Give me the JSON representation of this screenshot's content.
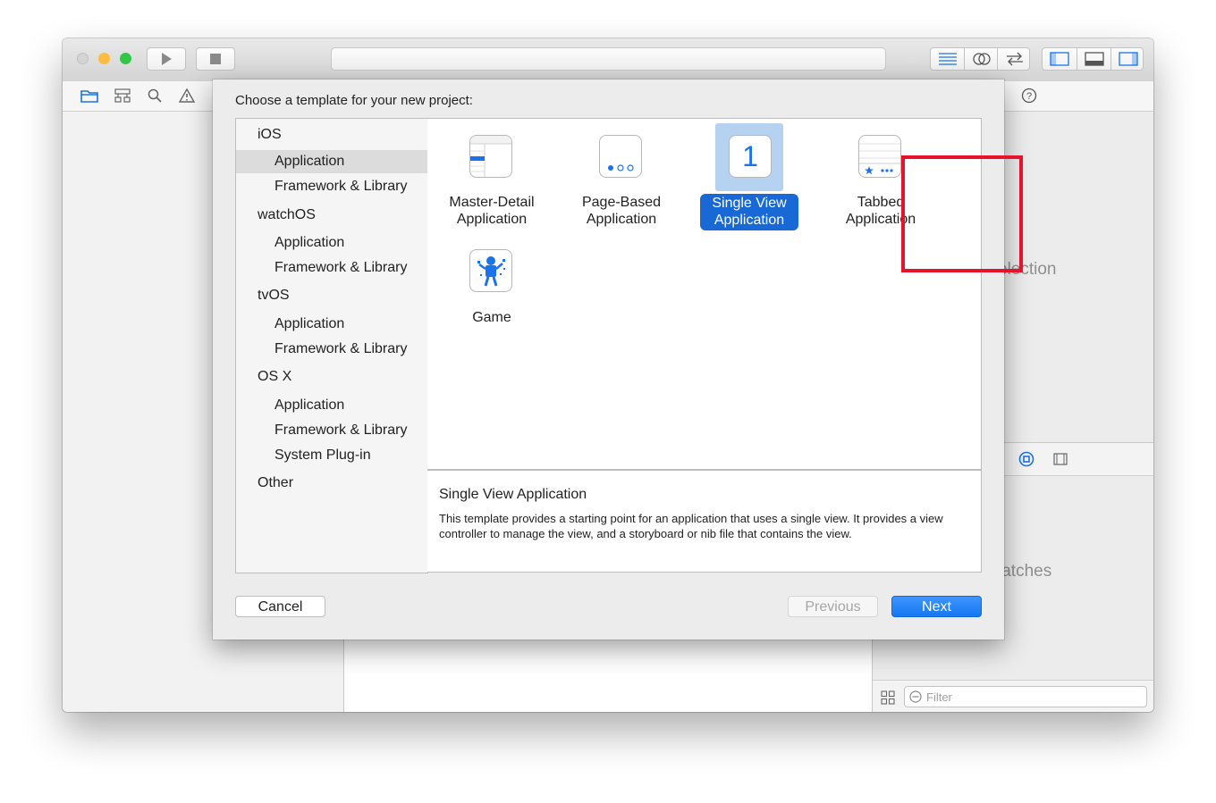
{
  "window": {
    "inspector_ghost_top": "election",
    "inspector_ghost_bottom": "latches",
    "filter_placeholder": "Filter"
  },
  "sheet": {
    "title": "Choose a template for your new project:",
    "sidebar": [
      {
        "label": "iOS",
        "type": "category"
      },
      {
        "label": "Application",
        "type": "item",
        "selected": true
      },
      {
        "label": "Framework & Library",
        "type": "item"
      },
      {
        "label": "watchOS",
        "type": "category"
      },
      {
        "label": "Application",
        "type": "item"
      },
      {
        "label": "Framework & Library",
        "type": "item"
      },
      {
        "label": "tvOS",
        "type": "category"
      },
      {
        "label": "Application",
        "type": "item"
      },
      {
        "label": "Framework & Library",
        "type": "item"
      },
      {
        "label": "OS X",
        "type": "category"
      },
      {
        "label": "Application",
        "type": "item"
      },
      {
        "label": "Framework & Library",
        "type": "item"
      },
      {
        "label": "System Plug-in",
        "type": "item"
      },
      {
        "label": "Other",
        "type": "category"
      }
    ],
    "templates": [
      {
        "line1": "Master-Detail",
        "line2": "Application",
        "icon": "master-detail-icon"
      },
      {
        "line1": "Page-Based",
        "line2": "Application",
        "icon": "page-based-icon"
      },
      {
        "line1": "Single View",
        "line2": "Application",
        "icon": "single-view-icon",
        "icon_text": "1",
        "selected": true
      },
      {
        "line1": "Tabbed",
        "line2": "Application",
        "icon": "tabbed-icon"
      },
      {
        "line1": "Game",
        "line2": "",
        "icon": "game-icon"
      }
    ],
    "description": {
      "title": "Single View Application",
      "text": "This template provides a starting point for an application that uses a single view. It provides a view controller to manage the view, and a storyboard or nib file that contains the view."
    },
    "buttons": {
      "cancel": "Cancel",
      "previous": "Previous",
      "next": "Next"
    }
  },
  "colors": {
    "accent": "#1478f4",
    "selection": "#1869d6",
    "highlight": "#e4142c"
  }
}
